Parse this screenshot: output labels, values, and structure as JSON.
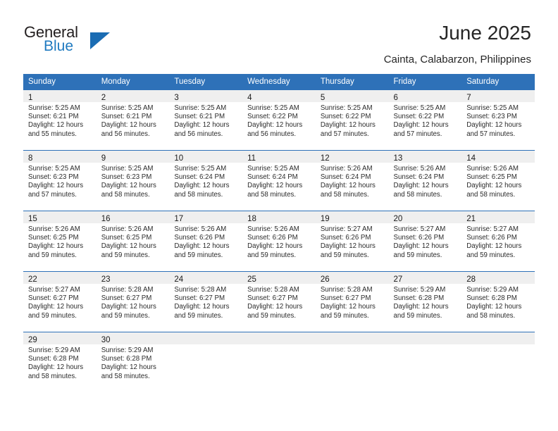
{
  "brand": {
    "name_top": "General",
    "name_bottom": "Blue",
    "triangle_icon": "triangle-icon",
    "color_dark": "#231f20",
    "color_blue": "#1f7ac0"
  },
  "header": {
    "title": "June 2025",
    "subtitle": "Cainta, Calabarzon, Philippines"
  },
  "theme": {
    "header_bg": "#2e71b8",
    "daynum_bg": "#efefef",
    "border": "#2e71b8",
    "text": "#2b2b2b"
  },
  "calendar": {
    "weekday_headers": [
      "Sunday",
      "Monday",
      "Tuesday",
      "Wednesday",
      "Thursday",
      "Friday",
      "Saturday"
    ],
    "labels": {
      "sunrise": "Sunrise:",
      "sunset": "Sunset:",
      "daylight": "Daylight:"
    },
    "weeks": [
      [
        {
          "day": "1",
          "sunrise": "Sunrise: 5:25 AM",
          "sunset": "Sunset: 6:21 PM",
          "daylight_line1": "Daylight: 12 hours",
          "daylight_line2": "and 55 minutes."
        },
        {
          "day": "2",
          "sunrise": "Sunrise: 5:25 AM",
          "sunset": "Sunset: 6:21 PM",
          "daylight_line1": "Daylight: 12 hours",
          "daylight_line2": "and 56 minutes."
        },
        {
          "day": "3",
          "sunrise": "Sunrise: 5:25 AM",
          "sunset": "Sunset: 6:21 PM",
          "daylight_line1": "Daylight: 12 hours",
          "daylight_line2": "and 56 minutes."
        },
        {
          "day": "4",
          "sunrise": "Sunrise: 5:25 AM",
          "sunset": "Sunset: 6:22 PM",
          "daylight_line1": "Daylight: 12 hours",
          "daylight_line2": "and 56 minutes."
        },
        {
          "day": "5",
          "sunrise": "Sunrise: 5:25 AM",
          "sunset": "Sunset: 6:22 PM",
          "daylight_line1": "Daylight: 12 hours",
          "daylight_line2": "and 57 minutes."
        },
        {
          "day": "6",
          "sunrise": "Sunrise: 5:25 AM",
          "sunset": "Sunset: 6:22 PM",
          "daylight_line1": "Daylight: 12 hours",
          "daylight_line2": "and 57 minutes."
        },
        {
          "day": "7",
          "sunrise": "Sunrise: 5:25 AM",
          "sunset": "Sunset: 6:23 PM",
          "daylight_line1": "Daylight: 12 hours",
          "daylight_line2": "and 57 minutes."
        }
      ],
      [
        {
          "day": "8",
          "sunrise": "Sunrise: 5:25 AM",
          "sunset": "Sunset: 6:23 PM",
          "daylight_line1": "Daylight: 12 hours",
          "daylight_line2": "and 57 minutes."
        },
        {
          "day": "9",
          "sunrise": "Sunrise: 5:25 AM",
          "sunset": "Sunset: 6:23 PM",
          "daylight_line1": "Daylight: 12 hours",
          "daylight_line2": "and 58 minutes."
        },
        {
          "day": "10",
          "sunrise": "Sunrise: 5:25 AM",
          "sunset": "Sunset: 6:24 PM",
          "daylight_line1": "Daylight: 12 hours",
          "daylight_line2": "and 58 minutes."
        },
        {
          "day": "11",
          "sunrise": "Sunrise: 5:25 AM",
          "sunset": "Sunset: 6:24 PM",
          "daylight_line1": "Daylight: 12 hours",
          "daylight_line2": "and 58 minutes."
        },
        {
          "day": "12",
          "sunrise": "Sunrise: 5:26 AM",
          "sunset": "Sunset: 6:24 PM",
          "daylight_line1": "Daylight: 12 hours",
          "daylight_line2": "and 58 minutes."
        },
        {
          "day": "13",
          "sunrise": "Sunrise: 5:26 AM",
          "sunset": "Sunset: 6:24 PM",
          "daylight_line1": "Daylight: 12 hours",
          "daylight_line2": "and 58 minutes."
        },
        {
          "day": "14",
          "sunrise": "Sunrise: 5:26 AM",
          "sunset": "Sunset: 6:25 PM",
          "daylight_line1": "Daylight: 12 hours",
          "daylight_line2": "and 58 minutes."
        }
      ],
      [
        {
          "day": "15",
          "sunrise": "Sunrise: 5:26 AM",
          "sunset": "Sunset: 6:25 PM",
          "daylight_line1": "Daylight: 12 hours",
          "daylight_line2": "and 59 minutes."
        },
        {
          "day": "16",
          "sunrise": "Sunrise: 5:26 AM",
          "sunset": "Sunset: 6:25 PM",
          "daylight_line1": "Daylight: 12 hours",
          "daylight_line2": "and 59 minutes."
        },
        {
          "day": "17",
          "sunrise": "Sunrise: 5:26 AM",
          "sunset": "Sunset: 6:26 PM",
          "daylight_line1": "Daylight: 12 hours",
          "daylight_line2": "and 59 minutes."
        },
        {
          "day": "18",
          "sunrise": "Sunrise: 5:26 AM",
          "sunset": "Sunset: 6:26 PM",
          "daylight_line1": "Daylight: 12 hours",
          "daylight_line2": "and 59 minutes."
        },
        {
          "day": "19",
          "sunrise": "Sunrise: 5:27 AM",
          "sunset": "Sunset: 6:26 PM",
          "daylight_line1": "Daylight: 12 hours",
          "daylight_line2": "and 59 minutes."
        },
        {
          "day": "20",
          "sunrise": "Sunrise: 5:27 AM",
          "sunset": "Sunset: 6:26 PM",
          "daylight_line1": "Daylight: 12 hours",
          "daylight_line2": "and 59 minutes."
        },
        {
          "day": "21",
          "sunrise": "Sunrise: 5:27 AM",
          "sunset": "Sunset: 6:26 PM",
          "daylight_line1": "Daylight: 12 hours",
          "daylight_line2": "and 59 minutes."
        }
      ],
      [
        {
          "day": "22",
          "sunrise": "Sunrise: 5:27 AM",
          "sunset": "Sunset: 6:27 PM",
          "daylight_line1": "Daylight: 12 hours",
          "daylight_line2": "and 59 minutes."
        },
        {
          "day": "23",
          "sunrise": "Sunrise: 5:28 AM",
          "sunset": "Sunset: 6:27 PM",
          "daylight_line1": "Daylight: 12 hours",
          "daylight_line2": "and 59 minutes."
        },
        {
          "day": "24",
          "sunrise": "Sunrise: 5:28 AM",
          "sunset": "Sunset: 6:27 PM",
          "daylight_line1": "Daylight: 12 hours",
          "daylight_line2": "and 59 minutes."
        },
        {
          "day": "25",
          "sunrise": "Sunrise: 5:28 AM",
          "sunset": "Sunset: 6:27 PM",
          "daylight_line1": "Daylight: 12 hours",
          "daylight_line2": "and 59 minutes."
        },
        {
          "day": "26",
          "sunrise": "Sunrise: 5:28 AM",
          "sunset": "Sunset: 6:27 PM",
          "daylight_line1": "Daylight: 12 hours",
          "daylight_line2": "and 59 minutes."
        },
        {
          "day": "27",
          "sunrise": "Sunrise: 5:29 AM",
          "sunset": "Sunset: 6:28 PM",
          "daylight_line1": "Daylight: 12 hours",
          "daylight_line2": "and 59 minutes."
        },
        {
          "day": "28",
          "sunrise": "Sunrise: 5:29 AM",
          "sunset": "Sunset: 6:28 PM",
          "daylight_line1": "Daylight: 12 hours",
          "daylight_line2": "and 58 minutes."
        }
      ],
      [
        {
          "day": "29",
          "sunrise": "Sunrise: 5:29 AM",
          "sunset": "Sunset: 6:28 PM",
          "daylight_line1": "Daylight: 12 hours",
          "daylight_line2": "and 58 minutes."
        },
        {
          "day": "30",
          "sunrise": "Sunrise: 5:29 AM",
          "sunset": "Sunset: 6:28 PM",
          "daylight_line1": "Daylight: 12 hours",
          "daylight_line2": "and 58 minutes."
        },
        {
          "day": "",
          "sunrise": "",
          "sunset": "",
          "daylight_line1": "",
          "daylight_line2": ""
        },
        {
          "day": "",
          "sunrise": "",
          "sunset": "",
          "daylight_line1": "",
          "daylight_line2": ""
        },
        {
          "day": "",
          "sunrise": "",
          "sunset": "",
          "daylight_line1": "",
          "daylight_line2": ""
        },
        {
          "day": "",
          "sunrise": "",
          "sunset": "",
          "daylight_line1": "",
          "daylight_line2": ""
        },
        {
          "day": "",
          "sunrise": "",
          "sunset": "",
          "daylight_line1": "",
          "daylight_line2": ""
        }
      ]
    ]
  }
}
